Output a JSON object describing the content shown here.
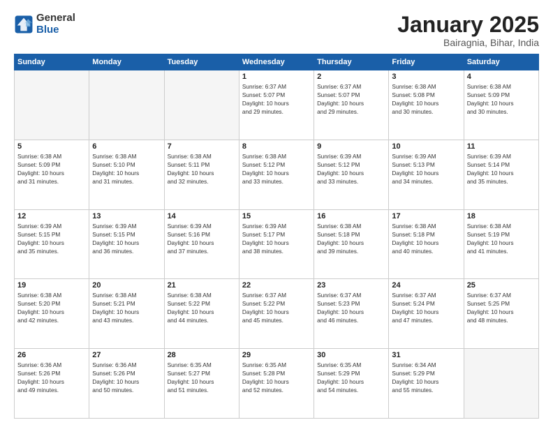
{
  "logo": {
    "general": "General",
    "blue": "Blue"
  },
  "header": {
    "title": "January 2025",
    "subtitle": "Bairagnia, Bihar, India"
  },
  "weekdays": [
    "Sunday",
    "Monday",
    "Tuesday",
    "Wednesday",
    "Thursday",
    "Friday",
    "Saturday"
  ],
  "weeks": [
    [
      {
        "day": "",
        "info": ""
      },
      {
        "day": "",
        "info": ""
      },
      {
        "day": "",
        "info": ""
      },
      {
        "day": "1",
        "info": "Sunrise: 6:37 AM\nSunset: 5:07 PM\nDaylight: 10 hours\nand 29 minutes."
      },
      {
        "day": "2",
        "info": "Sunrise: 6:37 AM\nSunset: 5:07 PM\nDaylight: 10 hours\nand 29 minutes."
      },
      {
        "day": "3",
        "info": "Sunrise: 6:38 AM\nSunset: 5:08 PM\nDaylight: 10 hours\nand 30 minutes."
      },
      {
        "day": "4",
        "info": "Sunrise: 6:38 AM\nSunset: 5:09 PM\nDaylight: 10 hours\nand 30 minutes."
      }
    ],
    [
      {
        "day": "5",
        "info": "Sunrise: 6:38 AM\nSunset: 5:09 PM\nDaylight: 10 hours\nand 31 minutes."
      },
      {
        "day": "6",
        "info": "Sunrise: 6:38 AM\nSunset: 5:10 PM\nDaylight: 10 hours\nand 31 minutes."
      },
      {
        "day": "7",
        "info": "Sunrise: 6:38 AM\nSunset: 5:11 PM\nDaylight: 10 hours\nand 32 minutes."
      },
      {
        "day": "8",
        "info": "Sunrise: 6:38 AM\nSunset: 5:12 PM\nDaylight: 10 hours\nand 33 minutes."
      },
      {
        "day": "9",
        "info": "Sunrise: 6:39 AM\nSunset: 5:12 PM\nDaylight: 10 hours\nand 33 minutes."
      },
      {
        "day": "10",
        "info": "Sunrise: 6:39 AM\nSunset: 5:13 PM\nDaylight: 10 hours\nand 34 minutes."
      },
      {
        "day": "11",
        "info": "Sunrise: 6:39 AM\nSunset: 5:14 PM\nDaylight: 10 hours\nand 35 minutes."
      }
    ],
    [
      {
        "day": "12",
        "info": "Sunrise: 6:39 AM\nSunset: 5:15 PM\nDaylight: 10 hours\nand 35 minutes."
      },
      {
        "day": "13",
        "info": "Sunrise: 6:39 AM\nSunset: 5:15 PM\nDaylight: 10 hours\nand 36 minutes."
      },
      {
        "day": "14",
        "info": "Sunrise: 6:39 AM\nSunset: 5:16 PM\nDaylight: 10 hours\nand 37 minutes."
      },
      {
        "day": "15",
        "info": "Sunrise: 6:39 AM\nSunset: 5:17 PM\nDaylight: 10 hours\nand 38 minutes."
      },
      {
        "day": "16",
        "info": "Sunrise: 6:38 AM\nSunset: 5:18 PM\nDaylight: 10 hours\nand 39 minutes."
      },
      {
        "day": "17",
        "info": "Sunrise: 6:38 AM\nSunset: 5:18 PM\nDaylight: 10 hours\nand 40 minutes."
      },
      {
        "day": "18",
        "info": "Sunrise: 6:38 AM\nSunset: 5:19 PM\nDaylight: 10 hours\nand 41 minutes."
      }
    ],
    [
      {
        "day": "19",
        "info": "Sunrise: 6:38 AM\nSunset: 5:20 PM\nDaylight: 10 hours\nand 42 minutes."
      },
      {
        "day": "20",
        "info": "Sunrise: 6:38 AM\nSunset: 5:21 PM\nDaylight: 10 hours\nand 43 minutes."
      },
      {
        "day": "21",
        "info": "Sunrise: 6:38 AM\nSunset: 5:22 PM\nDaylight: 10 hours\nand 44 minutes."
      },
      {
        "day": "22",
        "info": "Sunrise: 6:37 AM\nSunset: 5:22 PM\nDaylight: 10 hours\nand 45 minutes."
      },
      {
        "day": "23",
        "info": "Sunrise: 6:37 AM\nSunset: 5:23 PM\nDaylight: 10 hours\nand 46 minutes."
      },
      {
        "day": "24",
        "info": "Sunrise: 6:37 AM\nSunset: 5:24 PM\nDaylight: 10 hours\nand 47 minutes."
      },
      {
        "day": "25",
        "info": "Sunrise: 6:37 AM\nSunset: 5:25 PM\nDaylight: 10 hours\nand 48 minutes."
      }
    ],
    [
      {
        "day": "26",
        "info": "Sunrise: 6:36 AM\nSunset: 5:26 PM\nDaylight: 10 hours\nand 49 minutes."
      },
      {
        "day": "27",
        "info": "Sunrise: 6:36 AM\nSunset: 5:26 PM\nDaylight: 10 hours\nand 50 minutes."
      },
      {
        "day": "28",
        "info": "Sunrise: 6:35 AM\nSunset: 5:27 PM\nDaylight: 10 hours\nand 51 minutes."
      },
      {
        "day": "29",
        "info": "Sunrise: 6:35 AM\nSunset: 5:28 PM\nDaylight: 10 hours\nand 52 minutes."
      },
      {
        "day": "30",
        "info": "Sunrise: 6:35 AM\nSunset: 5:29 PM\nDaylight: 10 hours\nand 54 minutes."
      },
      {
        "day": "31",
        "info": "Sunrise: 6:34 AM\nSunset: 5:29 PM\nDaylight: 10 hours\nand 55 minutes."
      },
      {
        "day": "",
        "info": ""
      }
    ]
  ]
}
